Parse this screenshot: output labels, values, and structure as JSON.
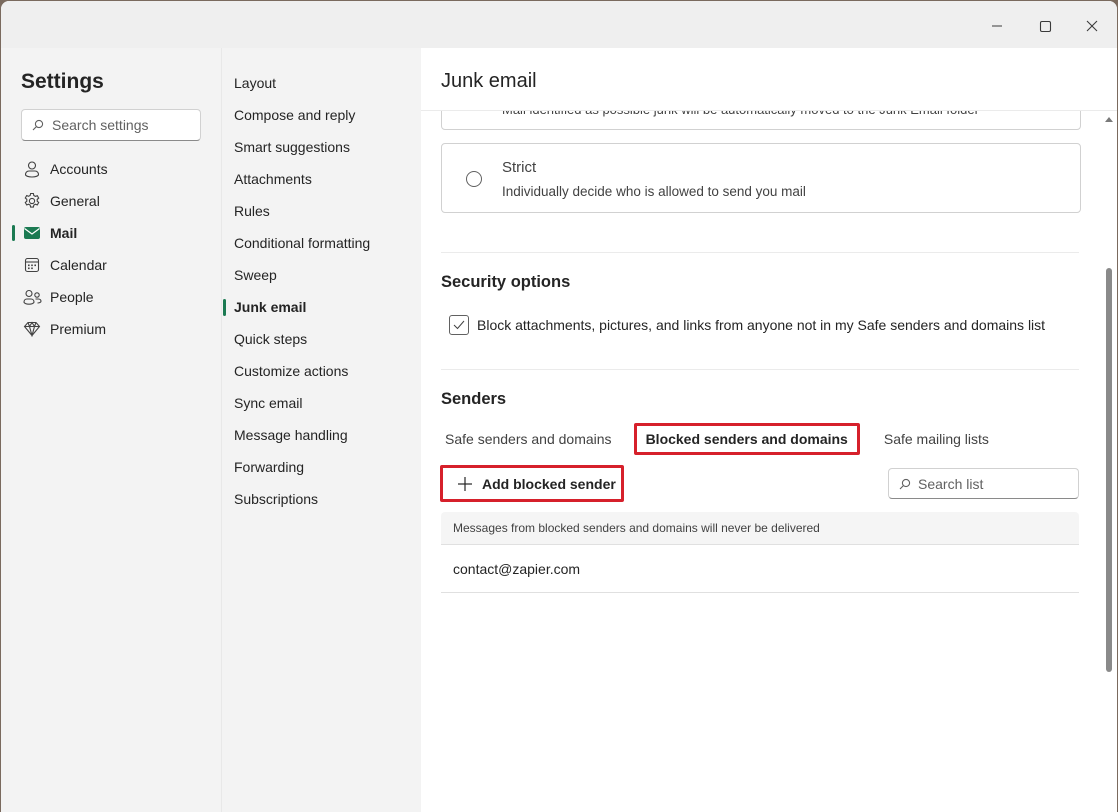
{
  "window": {
    "controls": {
      "minimize": "minimize",
      "maximize": "maximize",
      "close": "close"
    }
  },
  "sidebar": {
    "title": "Settings",
    "search_placeholder": "Search settings",
    "items": [
      {
        "label": "Accounts",
        "icon": "person-icon",
        "active": false
      },
      {
        "label": "General",
        "icon": "gear-icon",
        "active": false
      },
      {
        "label": "Mail",
        "icon": "mail-icon",
        "active": true
      },
      {
        "label": "Calendar",
        "icon": "calendar-icon",
        "active": false
      },
      {
        "label": "People",
        "icon": "people-icon",
        "active": false
      },
      {
        "label": "Premium",
        "icon": "diamond-icon",
        "active": false
      }
    ]
  },
  "mail_nav": {
    "items": [
      {
        "label": "Layout"
      },
      {
        "label": "Compose and reply"
      },
      {
        "label": "Smart suggestions"
      },
      {
        "label": "Attachments"
      },
      {
        "label": "Rules"
      },
      {
        "label": "Conditional formatting"
      },
      {
        "label": "Sweep"
      },
      {
        "label": "Junk email",
        "active": true
      },
      {
        "label": "Quick steps"
      },
      {
        "label": "Customize actions"
      },
      {
        "label": "Sync email"
      },
      {
        "label": "Message handling"
      },
      {
        "label": "Forwarding"
      },
      {
        "label": "Subscriptions"
      }
    ]
  },
  "content": {
    "title": "Junk email",
    "prev_option_desc": "Mail identified as possible junk will be automatically moved to the Junk Email folder",
    "strict_option": {
      "label": "Strict",
      "description": "Individually decide who is allowed to send you mail",
      "selected": false
    },
    "security": {
      "title": "Security options",
      "checkbox_label": "Block attachments, pictures, and links from anyone not in my Safe senders and domains list",
      "checked": true
    },
    "senders": {
      "title": "Senders",
      "tabs": [
        {
          "label": "Safe senders and domains",
          "active": false
        },
        {
          "label": "Blocked senders and domains",
          "active": true
        },
        {
          "label": "Safe mailing lists",
          "active": false
        }
      ],
      "add_button": "Add blocked sender",
      "search_placeholder": "Search list",
      "list_header": "Messages from blocked senders and domains will never be delivered",
      "entries": [
        "contact@zapier.com"
      ]
    }
  },
  "colors": {
    "accent": "#1b7a52",
    "highlight_box": "#d6202b"
  }
}
